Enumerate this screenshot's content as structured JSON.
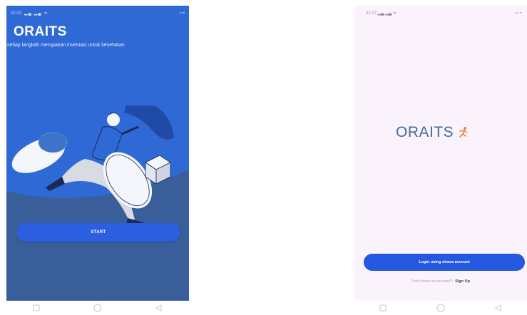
{
  "splash": {
    "status_time": "02.02",
    "title": "ORAITS",
    "tagline": "setiap langkah merupakan investasi untuk kesehatan",
    "start_label": "START"
  },
  "login": {
    "status_time": "02.02",
    "logo_text": "ORAITS",
    "login_label": "Login using strava account",
    "signup_prompt": "Don't have an account?",
    "signup_link": "Sign Up"
  },
  "colors": {
    "splash_bg": "#2f69d6",
    "splash_bottom": "#3a5e9a",
    "button_blue": "#2458e0",
    "login_bg": "#fbf3fb",
    "logo_color": "#3d6f97"
  },
  "icons": {
    "status": [
      "signal-icon",
      "wifi-icon",
      "battery-icon"
    ],
    "nav": [
      "recents-square-icon",
      "home-circle-icon",
      "back-triangle-icon"
    ],
    "logo": "runner-icon"
  }
}
